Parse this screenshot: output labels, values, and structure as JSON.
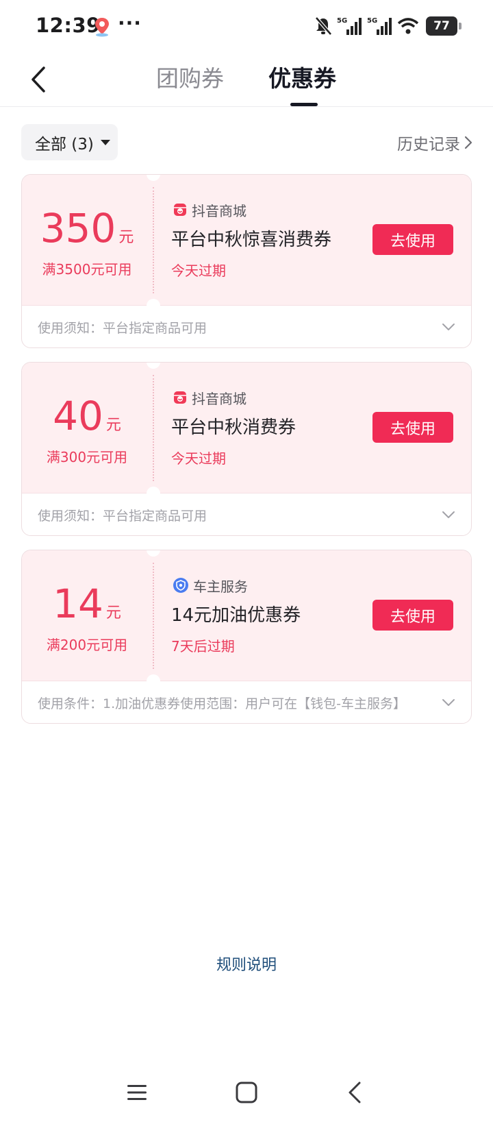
{
  "status_bar": {
    "time": "12:39",
    "dots": "···",
    "network1": "5G",
    "network2": "5G",
    "battery": "77",
    "icons": [
      "location-app-icon",
      "bell-off-icon",
      "signal-icon",
      "signal-icon",
      "wifi-icon",
      "battery-icon"
    ]
  },
  "header": {
    "tabs": [
      {
        "label": "团购券",
        "active": false
      },
      {
        "label": "优惠券",
        "active": true
      }
    ]
  },
  "filter": {
    "label": "全部 (3)",
    "history_label": "历史记录"
  },
  "coupons": [
    {
      "amount": "350",
      "unit": "元",
      "threshold": "满3500元可用",
      "merchant": "抖音商城",
      "merchant_icon": "shop-icon",
      "title": "平台中秋惊喜消费券",
      "expiry": "今天过期",
      "action": "去使用",
      "notice": "使用须知：平台指定商品可用"
    },
    {
      "amount": "40",
      "unit": "元",
      "threshold": "满300元可用",
      "merchant": "抖音商城",
      "merchant_icon": "shop-icon",
      "title": "平台中秋消费券",
      "expiry": "今天过期",
      "action": "去使用",
      "notice": "使用须知：平台指定商品可用"
    },
    {
      "amount": "14",
      "unit": "元",
      "threshold": "满200元可用",
      "merchant": "车主服务",
      "merchant_icon": "car-service-icon",
      "title": "14元加油优惠券",
      "expiry": "7天后过期",
      "action": "去使用",
      "notice": "使用条件：1.加油优惠券使用范围：用户可在【钱包-车主服务】"
    }
  ],
  "rules_label": "规则说明",
  "colors": {
    "accent": "#f02b55",
    "price": "#ea3b5b",
    "card_bg": "#feeff1",
    "link": "#1e4d7a"
  },
  "nav_bar": {
    "icons": [
      "menu-icon",
      "home-square-icon",
      "back-triangle-icon"
    ]
  }
}
